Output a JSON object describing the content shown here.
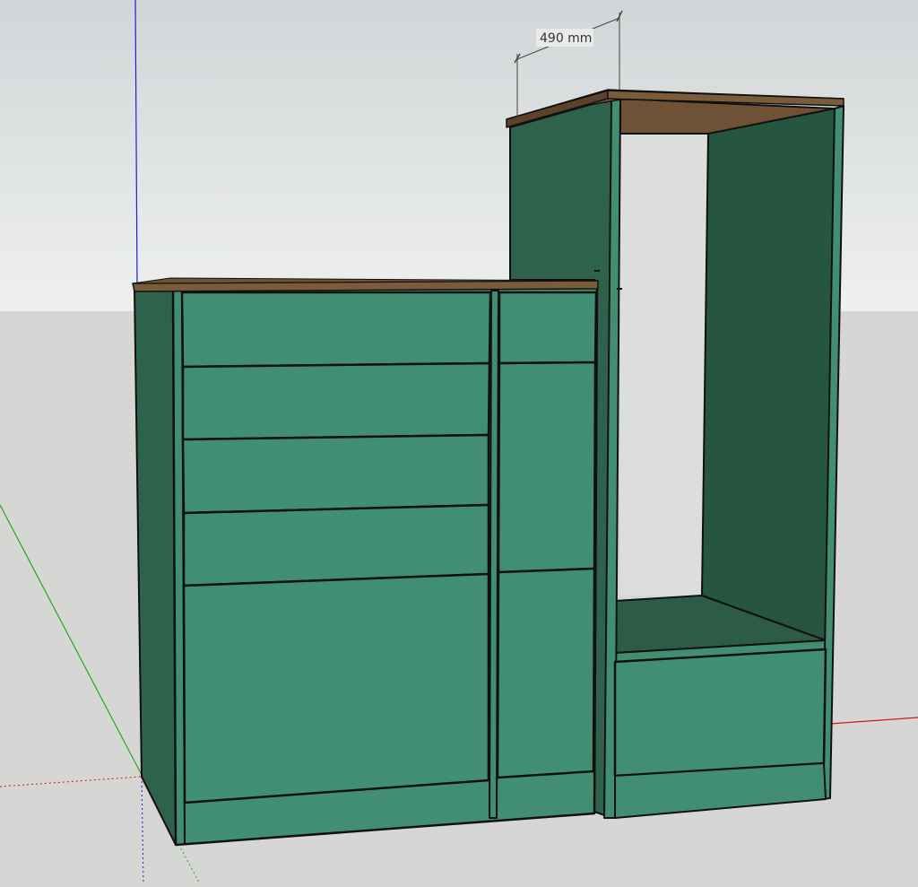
{
  "model": {
    "dimension": {
      "label": "490 mm"
    },
    "colors": {
      "sky_top": "#d2d5d7",
      "sky_bottom": "#eef0f0",
      "ground": "#d6d6d4",
      "panel_front": "#418e72",
      "panel_side_dark": "#2f624c",
      "panel_interior": "#26563f",
      "wood_top": "#7a5c3a",
      "wood_edge": "#5c4228",
      "edge_line": "#111111",
      "axis_blue": "#1a22cc",
      "axis_green": "#1faa1f",
      "axis_red": "#cc1a1a"
    },
    "components": {
      "left_cabinet": {
        "drawers_wide": 5,
        "drawers_narrow": 3
      },
      "tall_cabinet": {
        "open_bay": true,
        "drawers": 1
      }
    }
  }
}
